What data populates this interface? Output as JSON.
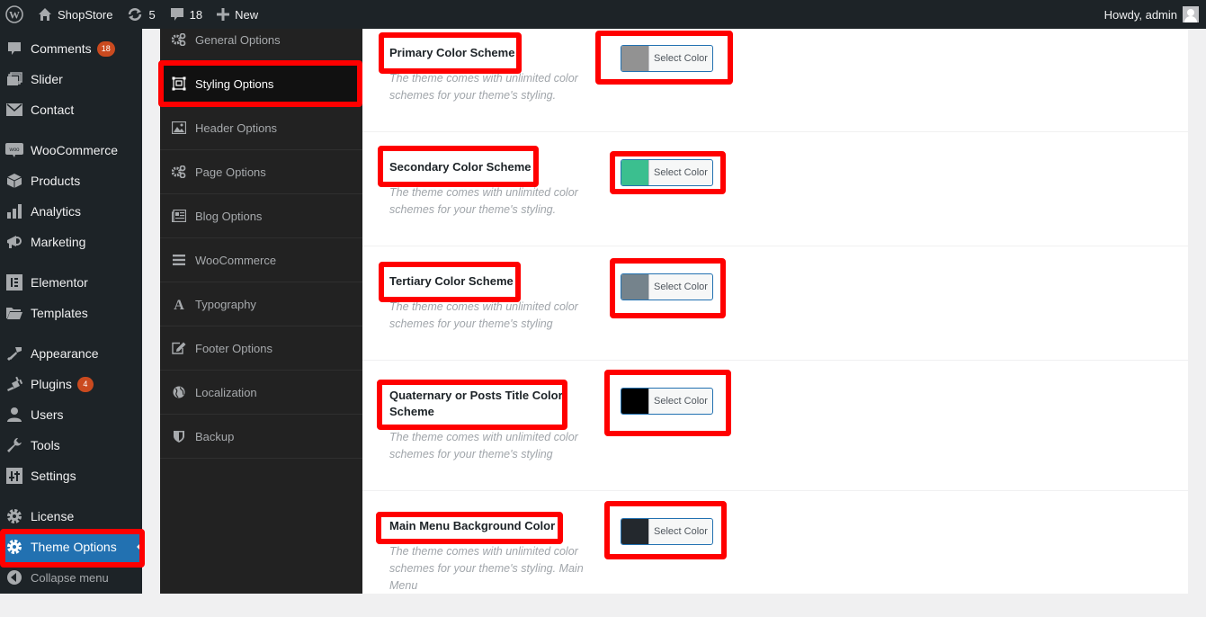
{
  "adminbar": {
    "site_name": "ShopStore",
    "updates_count": "5",
    "comments_count": "18",
    "new_label": "New",
    "howdy": "Howdy, admin"
  },
  "adminmenu": {
    "items": [
      {
        "label": "Comments",
        "icon": "comment-icon",
        "badge": "18"
      },
      {
        "label": "Slider",
        "icon": "slider-icon"
      },
      {
        "label": "Contact",
        "icon": "envelope-icon"
      },
      {
        "label": "WooCommerce",
        "icon": "woo-icon"
      },
      {
        "label": "Products",
        "icon": "box-icon"
      },
      {
        "label": "Analytics",
        "icon": "bar-chart-icon"
      },
      {
        "label": "Marketing",
        "icon": "megaphone-icon"
      },
      {
        "label": "Elementor",
        "icon": "elementor-icon"
      },
      {
        "label": "Templates",
        "icon": "folder-icon"
      },
      {
        "label": "Appearance",
        "icon": "paintbrush-icon"
      },
      {
        "label": "Plugins",
        "icon": "plug-icon",
        "badge": "4"
      },
      {
        "label": "Users",
        "icon": "user-icon"
      },
      {
        "label": "Tools",
        "icon": "wrench-icon"
      },
      {
        "label": "Settings",
        "icon": "sliders-icon"
      },
      {
        "label": "License",
        "icon": "gear-icon"
      },
      {
        "label": "Theme Options",
        "icon": "gear-icon",
        "active": true
      },
      {
        "label": "Collapse menu",
        "icon": "collapse-icon"
      }
    ]
  },
  "options_nav": {
    "items": [
      {
        "label": "General Options",
        "icon": "gears-icon"
      },
      {
        "label": "Styling Options",
        "icon": "styling-icon",
        "active": true
      },
      {
        "label": "Header Options",
        "icon": "image-icon"
      },
      {
        "label": "Page Options",
        "icon": "gears-icon"
      },
      {
        "label": "Blog Options",
        "icon": "newspaper-icon"
      },
      {
        "label": "WooCommerce",
        "icon": "list-icon"
      },
      {
        "label": "Typography",
        "icon": "font-icon"
      },
      {
        "label": "Footer Options",
        "icon": "edit-icon"
      },
      {
        "label": "Localization",
        "icon": "globe-icon"
      },
      {
        "label": "Backup",
        "icon": "shield-icon"
      }
    ]
  },
  "fields": [
    {
      "title": "Primary Color Scheme",
      "desc": "The theme comes with unlimited color schemes for your theme's styling.",
      "button": "Select Color",
      "color": "#929292"
    },
    {
      "title": "Secondary Color Scheme",
      "desc": "The theme comes with unlimited color schemes for your theme's styling.",
      "button": "Select Color",
      "color": "#3bbf8f"
    },
    {
      "title": "Tertiary Color Scheme",
      "desc": "The theme comes with unlimited color schemes for your theme's styling",
      "button": "Select Color",
      "color": "#75838c"
    },
    {
      "title": "Quaternary or Posts Title Color Scheme",
      "desc": "The theme comes with unlimited color schemes for your theme's styling",
      "button": "Select Color",
      "color": "#000000"
    },
    {
      "title": "Main Menu Background Color",
      "desc": "The theme comes with unlimited color schemes for your theme's styling. Main Menu",
      "button": "Select Color",
      "color": "#23282d"
    }
  ],
  "colors": {
    "highlight": "#ff0000",
    "admin_accent": "#2271b1"
  }
}
